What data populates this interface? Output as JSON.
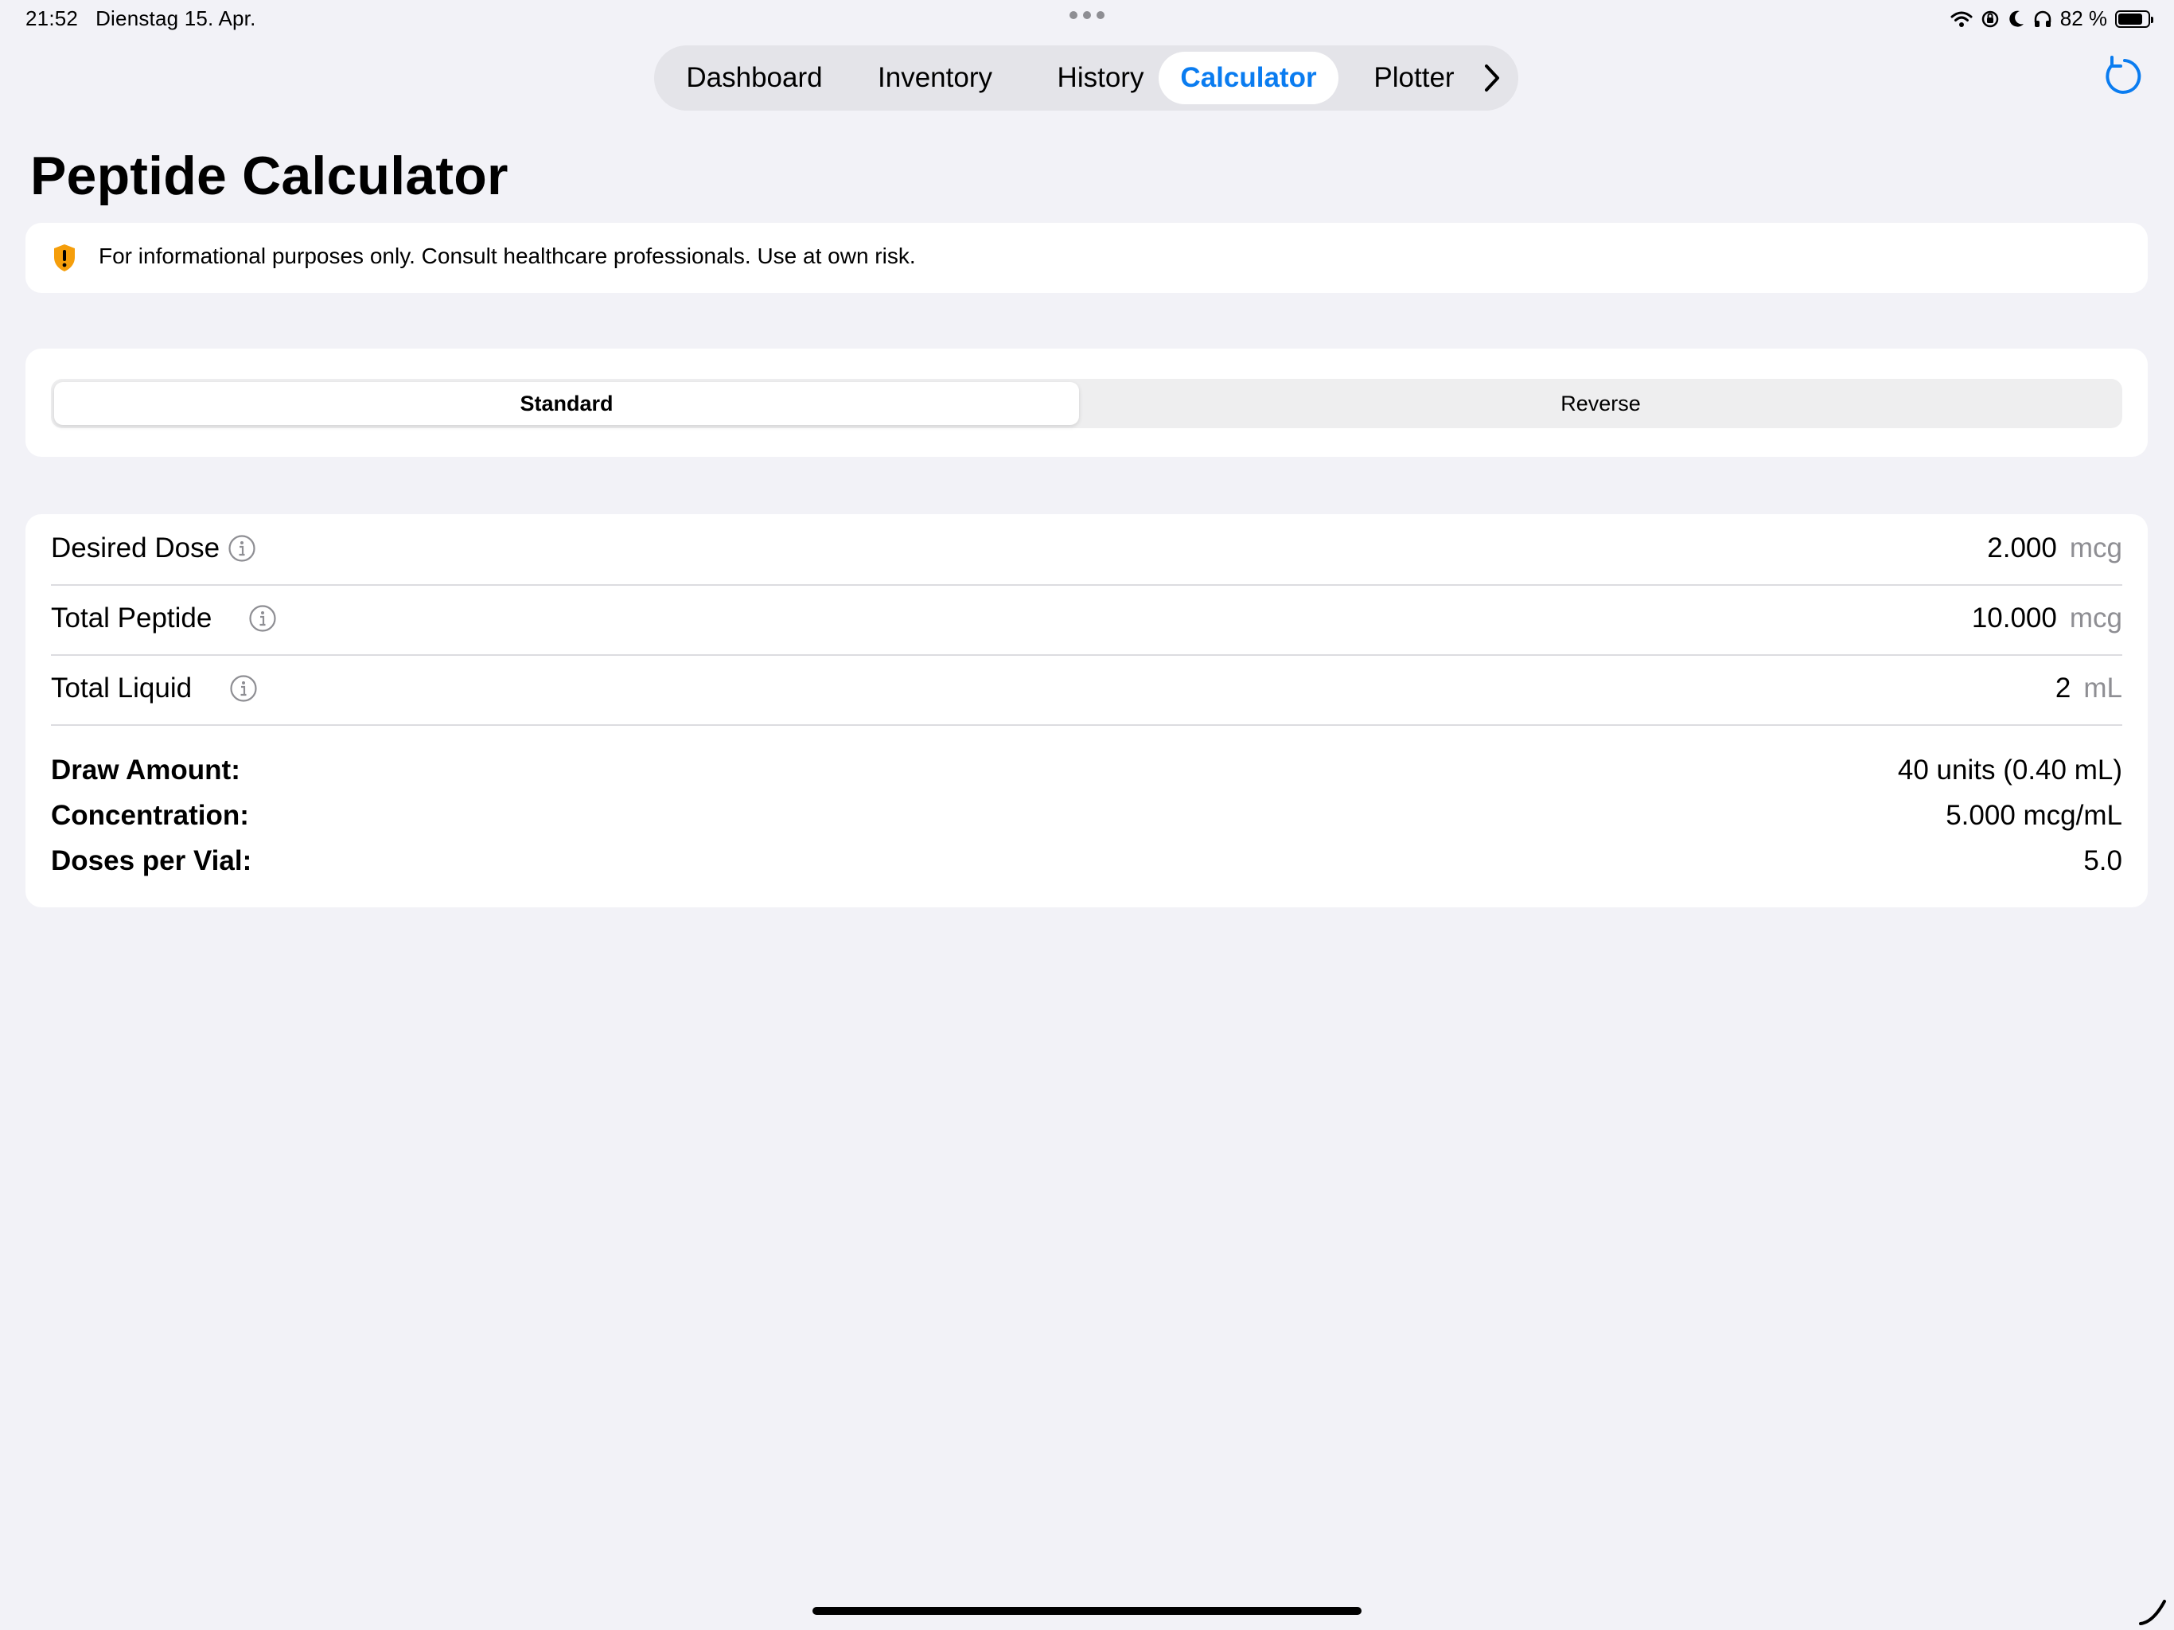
{
  "status_bar": {
    "time": "21:52",
    "date": "Dienstag 15. Apr.",
    "battery_percent": "82 %",
    "battery_level": 0.82
  },
  "tabs": [
    {
      "label": "Dashboard",
      "active": false
    },
    {
      "label": "Inventory",
      "active": false
    },
    {
      "label": "History",
      "active": false
    },
    {
      "label": "Calculator",
      "active": true
    },
    {
      "label": "Plotter",
      "active": false
    }
  ],
  "page": {
    "title": "Peptide Calculator"
  },
  "disclaimer": {
    "icon": "warning-shield-icon",
    "text": "For informational purposes only. Consult healthcare professionals. Use at own risk."
  },
  "mode": {
    "options": [
      "Standard",
      "Reverse"
    ],
    "selected": "Standard"
  },
  "inputs": [
    {
      "label": "Desired Dose",
      "value": "2.000",
      "unit": "mcg"
    },
    {
      "label": "Total Peptide",
      "value": "10.000",
      "unit": "mcg"
    },
    {
      "label": "Total Liquid",
      "value": "2",
      "unit": "mL"
    }
  ],
  "results": [
    {
      "label": "Draw Amount:",
      "value": "40 units (0.40 mL)"
    },
    {
      "label": "Concentration:",
      "value": "5.000 mcg/mL"
    },
    {
      "label": "Doses per Vial:",
      "value": "5.0"
    }
  ],
  "colors": {
    "accent": "#0a7cf0",
    "warning": "#f59e0b",
    "background": "#f2f2f7",
    "unit_gray": "#8e8e93"
  }
}
